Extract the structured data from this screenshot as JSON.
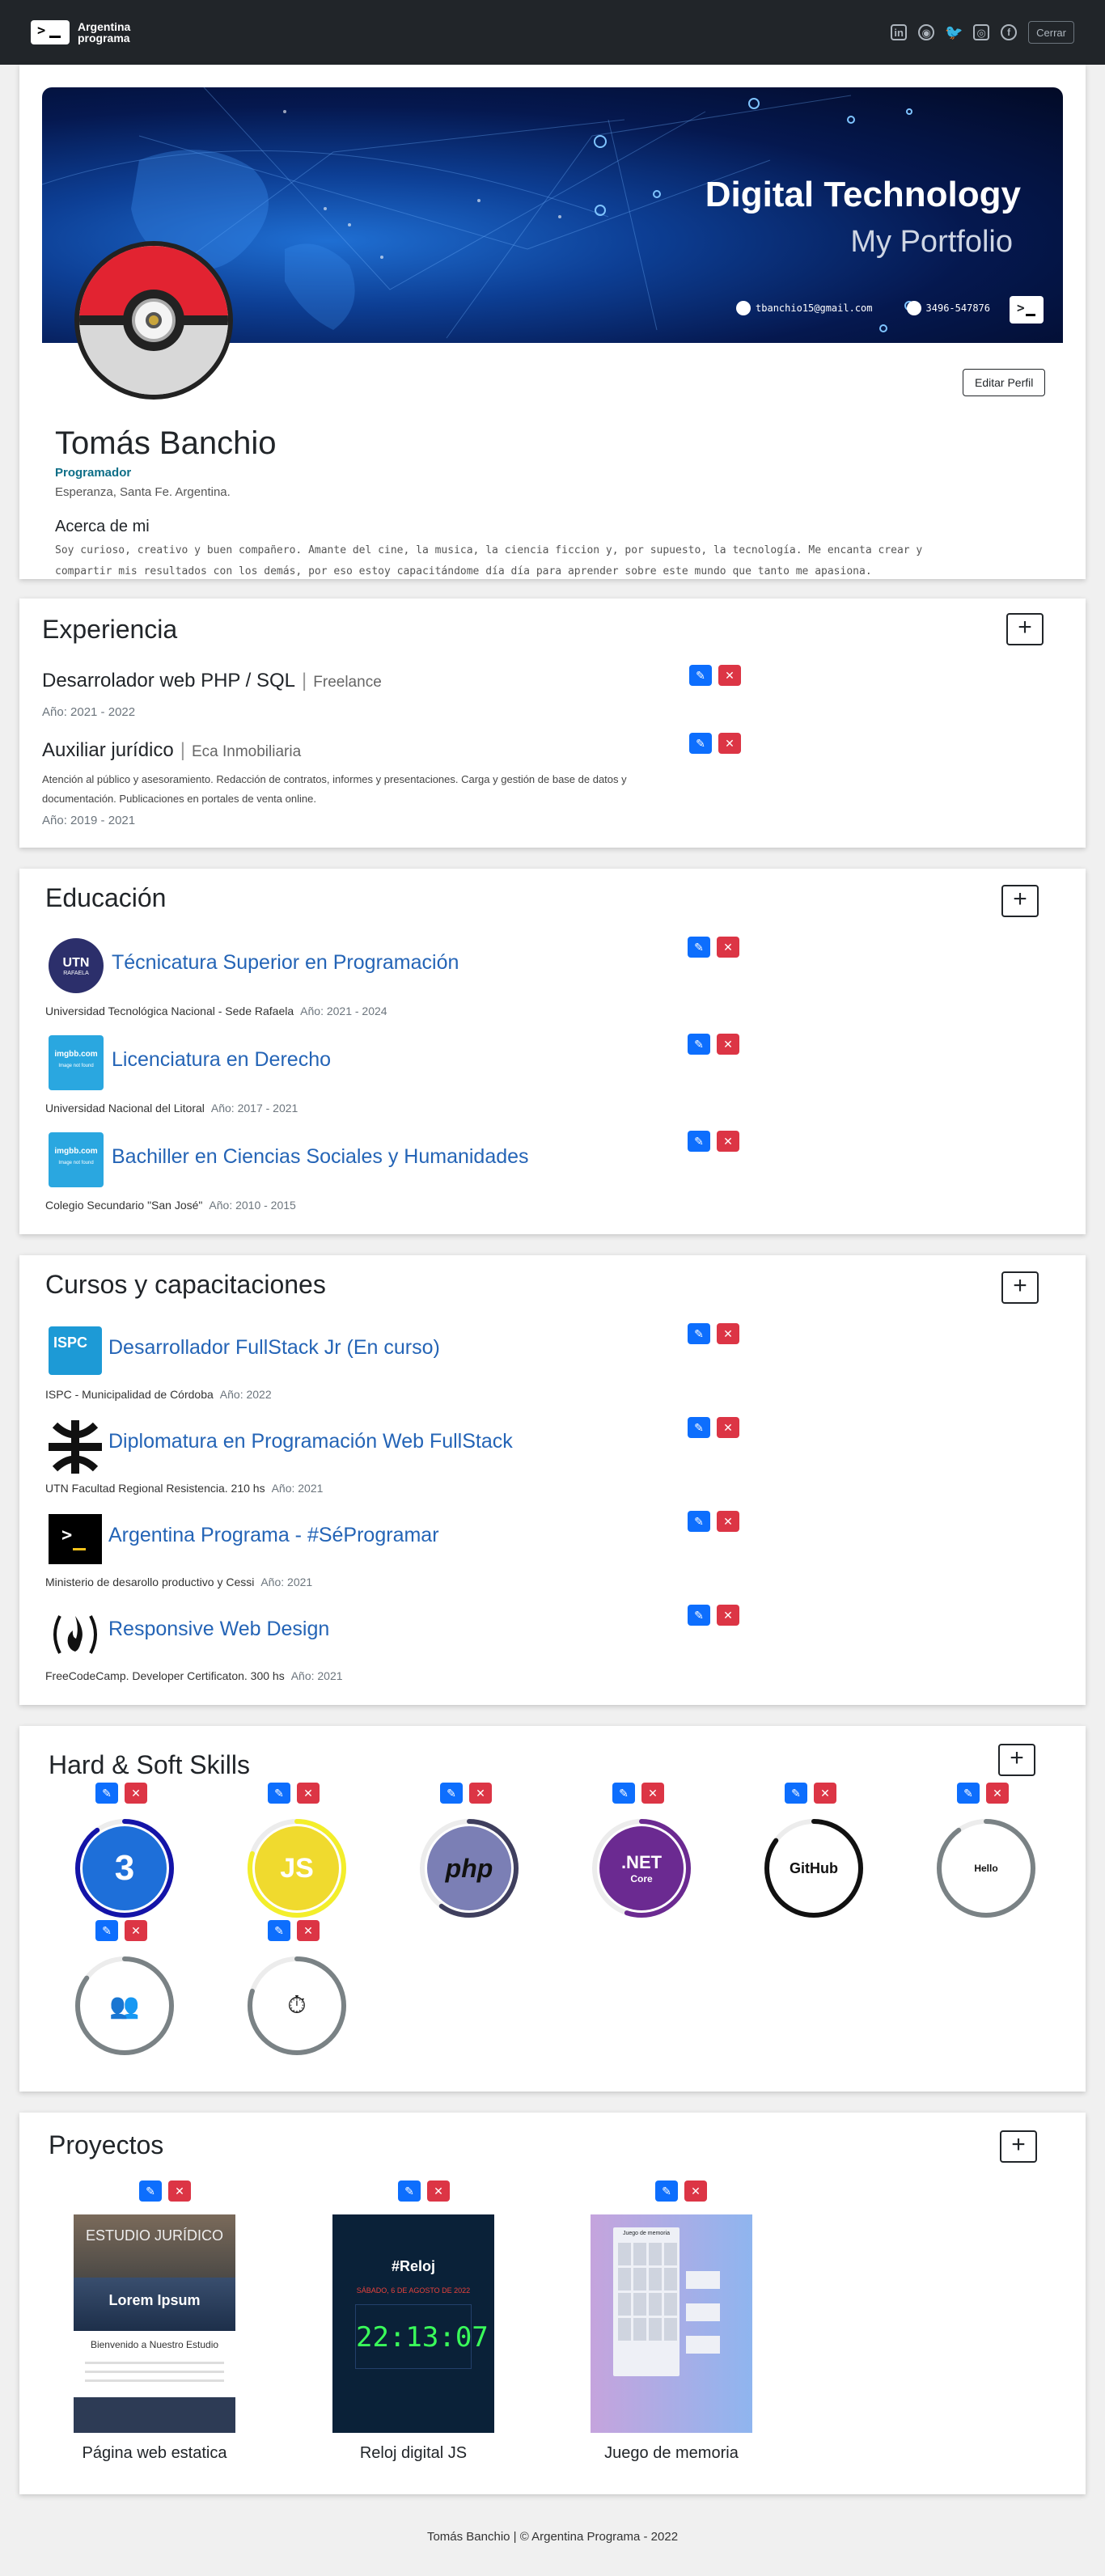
{
  "nav": {
    "brand": "Argentina programa",
    "logout": "Cerrar",
    "social": [
      "linkedin-icon",
      "github-icon",
      "twitter-icon",
      "instagram-icon",
      "facebook-icon"
    ]
  },
  "profile": {
    "banner_title": "Digital Technology",
    "banner_sub": "My Portfolio",
    "email": "tbanchio15@gmail.com",
    "phone": "3496-547876",
    "edit_label": "Editar Perfil",
    "name": "Tomás Banchio",
    "role": "Programador",
    "location": "Esperanza, Santa Fe. Argentina.",
    "about_title": "Acerca de mi",
    "about_text": "Soy curioso, creativo y buen compañero. Amante del cine, la musica, la ciencia ficcion y, por supuesto, la tecnología. Me encanta crear y compartir mis resultados con los demás, por eso estoy capacitándome día día para aprender sobre este mundo que tanto me apasiona."
  },
  "experience": {
    "title": "Experiencia",
    "items": [
      {
        "role": "Desarrolador web PHP / SQL",
        "company": "Freelance",
        "year": "Año: 2021 - 2022",
        "desc": ""
      },
      {
        "role": "Auxiliar jurídico",
        "company": "Eca Inmobiliaria",
        "year": "Año: 2019 - 2021",
        "desc": "Atención al público y asesoramiento. Redacción de contratos, informes y presentaciones. Carga y gestión de base de datos y documentación. Publicaciones en portales de venta online."
      }
    ]
  },
  "education": {
    "title": "Educación",
    "items": [
      {
        "title": "Técnicatura Superior en Programación",
        "inst": "Universidad Tecnológica Nacional - Sede Rafaela",
        "year": "Año: 2021 - 2024",
        "logo_text": "UTN",
        "logo_sub": "RAFAELA"
      },
      {
        "title": "Licenciatura en Derecho",
        "inst": "Universidad Nacional del Litoral",
        "year": "Año: 2017 - 2021",
        "logo_text": "imgbb.com",
        "logo_sub": "Image not found"
      },
      {
        "title": "Bachiller en Ciencias Sociales y Humanidades",
        "inst": "Colegio Secundario \"San José\"",
        "year": "Año: 2010 - 2015",
        "logo_text": "imgbb.com",
        "logo_sub": "Image not found"
      }
    ]
  },
  "courses": {
    "title": "Cursos y capacitaciones",
    "items": [
      {
        "title": "Desarrollador FullStack Jr (En curso)",
        "inst": "ISPC - Municipalidad de Córdoba",
        "year": "Año: 2022",
        "logo_text": "ISPC"
      },
      {
        "title": "Diplomatura en Programación Web FullStack",
        "inst": "UTN Facultad Regional Resistencia. 210 hs",
        "year": "Año: 2021"
      },
      {
        "title": "Argentina Programa - #SéProgramar",
        "inst": "Ministerio de desarollo productivo y Cessi",
        "year": "Año: 2021"
      },
      {
        "title": "Responsive Web Design",
        "inst": "FreeCodeCamp. Developer Certificaton. 300 hs",
        "year": "Año: 2021"
      }
    ]
  },
  "skills": {
    "title": "Hard & Soft Skills",
    "items": [
      {
        "name": "css-icon",
        "text": "3",
        "percent": 90,
        "color": "#1414a8"
      },
      {
        "name": "js-icon",
        "text": "JS",
        "percent": 80,
        "color": "#f3ee2b"
      },
      {
        "name": "php-icon",
        "text": "php",
        "percent": 60,
        "color": "#3f3f5e"
      },
      {
        "name": "dotnet-icon",
        "text": ".NET",
        "sub": "Core",
        "percent": 55,
        "color": "#6b2a91"
      },
      {
        "name": "github-icon",
        "text": "GitHub",
        "percent": 85,
        "color": "#111111"
      },
      {
        "name": "communication-icon",
        "text": "Hello",
        "percent": 90,
        "color": "#7a8285"
      },
      {
        "name": "teamwork-icon",
        "text": "",
        "percent": 85,
        "color": "#7a8285"
      },
      {
        "name": "time-management-icon",
        "text": "",
        "percent": 80,
        "color": "#7a8285"
      }
    ]
  },
  "projects": {
    "title": "Proyectos",
    "items": [
      {
        "name": "Página web estatica",
        "img_title": "ESTUDIO JURÍDICO",
        "img_sub": "Lorem Ipsum",
        "img_text": "Bienvenido a Nuestro Estudio"
      },
      {
        "name": "Reloj digital JS",
        "img_title": "#Reloj",
        "img_sub": "SÁBADO, 6 DE AGOSTO DE 2022",
        "img_text": "22:13:07"
      },
      {
        "name": "Juego de memoria",
        "img_title": "Juego de memoria",
        "img_sub": "",
        "img_text": ""
      }
    ]
  },
  "footer": "Tomás Banchio | © Argentina Programa - 2022"
}
